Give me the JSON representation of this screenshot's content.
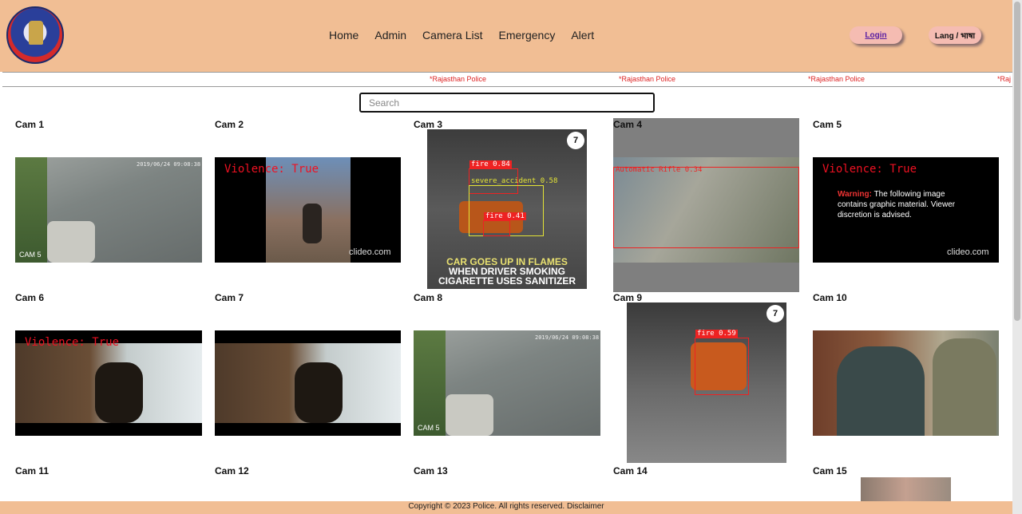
{
  "header": {
    "nav": [
      "Home",
      "Admin",
      "Camera List",
      "Emergency",
      "Alert"
    ],
    "login_label": "Login",
    "lang_label": "Lang / भाषा"
  },
  "ticker": {
    "items": [
      "*Rajasthan Police",
      "*Rajasthan Police",
      "*Rajasthan Police",
      "*Raj"
    ]
  },
  "search": {
    "placeholder": "Search"
  },
  "cams": [
    "Cam 1",
    "Cam 2",
    "Cam 3",
    "Cam 4",
    "Cam 5",
    "Cam 6",
    "Cam 7",
    "Cam 8",
    "Cam 9",
    "Cam 10",
    "Cam 11",
    "Cam 12",
    "Cam 13",
    "Cam 14",
    "Cam 15"
  ],
  "overlays": {
    "violence": "Violence: True",
    "violence6": "Violence: True",
    "clideo": "clideo.com",
    "clideo5": "clideo.com",
    "cam5_tag": "CAM 5",
    "cam5_tag8": "CAM 5",
    "warning_word": "Warning:",
    "warning_text": " The following image contains graphic material. Viewer discretion is advised.",
    "fire1": "fire  0.84",
    "accident": "severe_accident  0.58",
    "fire2": "fire  0.41",
    "fire9": "fire  0.59",
    "auto_rifle": "Automatic Rifle  0.34",
    "caption": [
      "CAR GOES UP IN FLAMES",
      "WHEN DRIVER SMOKING",
      "CIGARETTE USES SANITIZER"
    ],
    "abc7": "7",
    "abc7b": "7"
  },
  "footer": {
    "text": "Copyright © 2023 Police. All rights reserved. Disclaimer"
  }
}
